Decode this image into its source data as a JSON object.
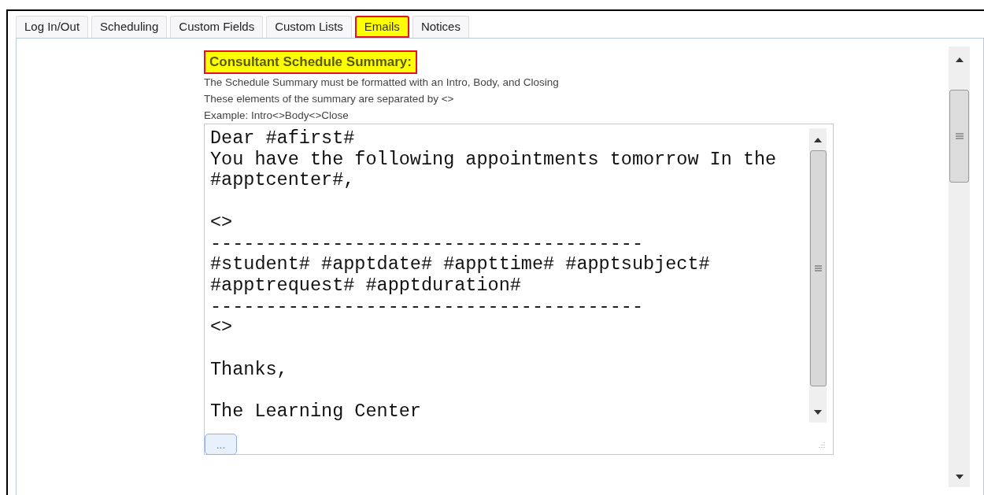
{
  "tabs": [
    {
      "label": "Log In/Out",
      "selected": false
    },
    {
      "label": "Scheduling",
      "selected": false
    },
    {
      "label": "Custom Fields",
      "selected": false
    },
    {
      "label": "Custom Lists",
      "selected": false
    },
    {
      "label": "Emails",
      "selected": true
    },
    {
      "label": "Notices",
      "selected": false
    }
  ],
  "section": {
    "title": "Consultant Schedule Summary:",
    "instructions": [
      "The Schedule Summary must be formatted with an Intro, Body, and Closing",
      "These elements of the summary are separated by <>",
      "Example: Intro<>Body<>Close"
    ],
    "editor": {
      "value": "Dear #afirst#\nYou have the following appointments tomorrow In the\n#apptcenter#,\n\n<>\n---------------------------------------\n#student# #apptdate# #appttime# #apptsubject#\n#apptrequest# #apptduration#\n---------------------------------------\n<>\n\nThanks,\n\nThe Learning Center"
    },
    "more_button": "..."
  }
}
